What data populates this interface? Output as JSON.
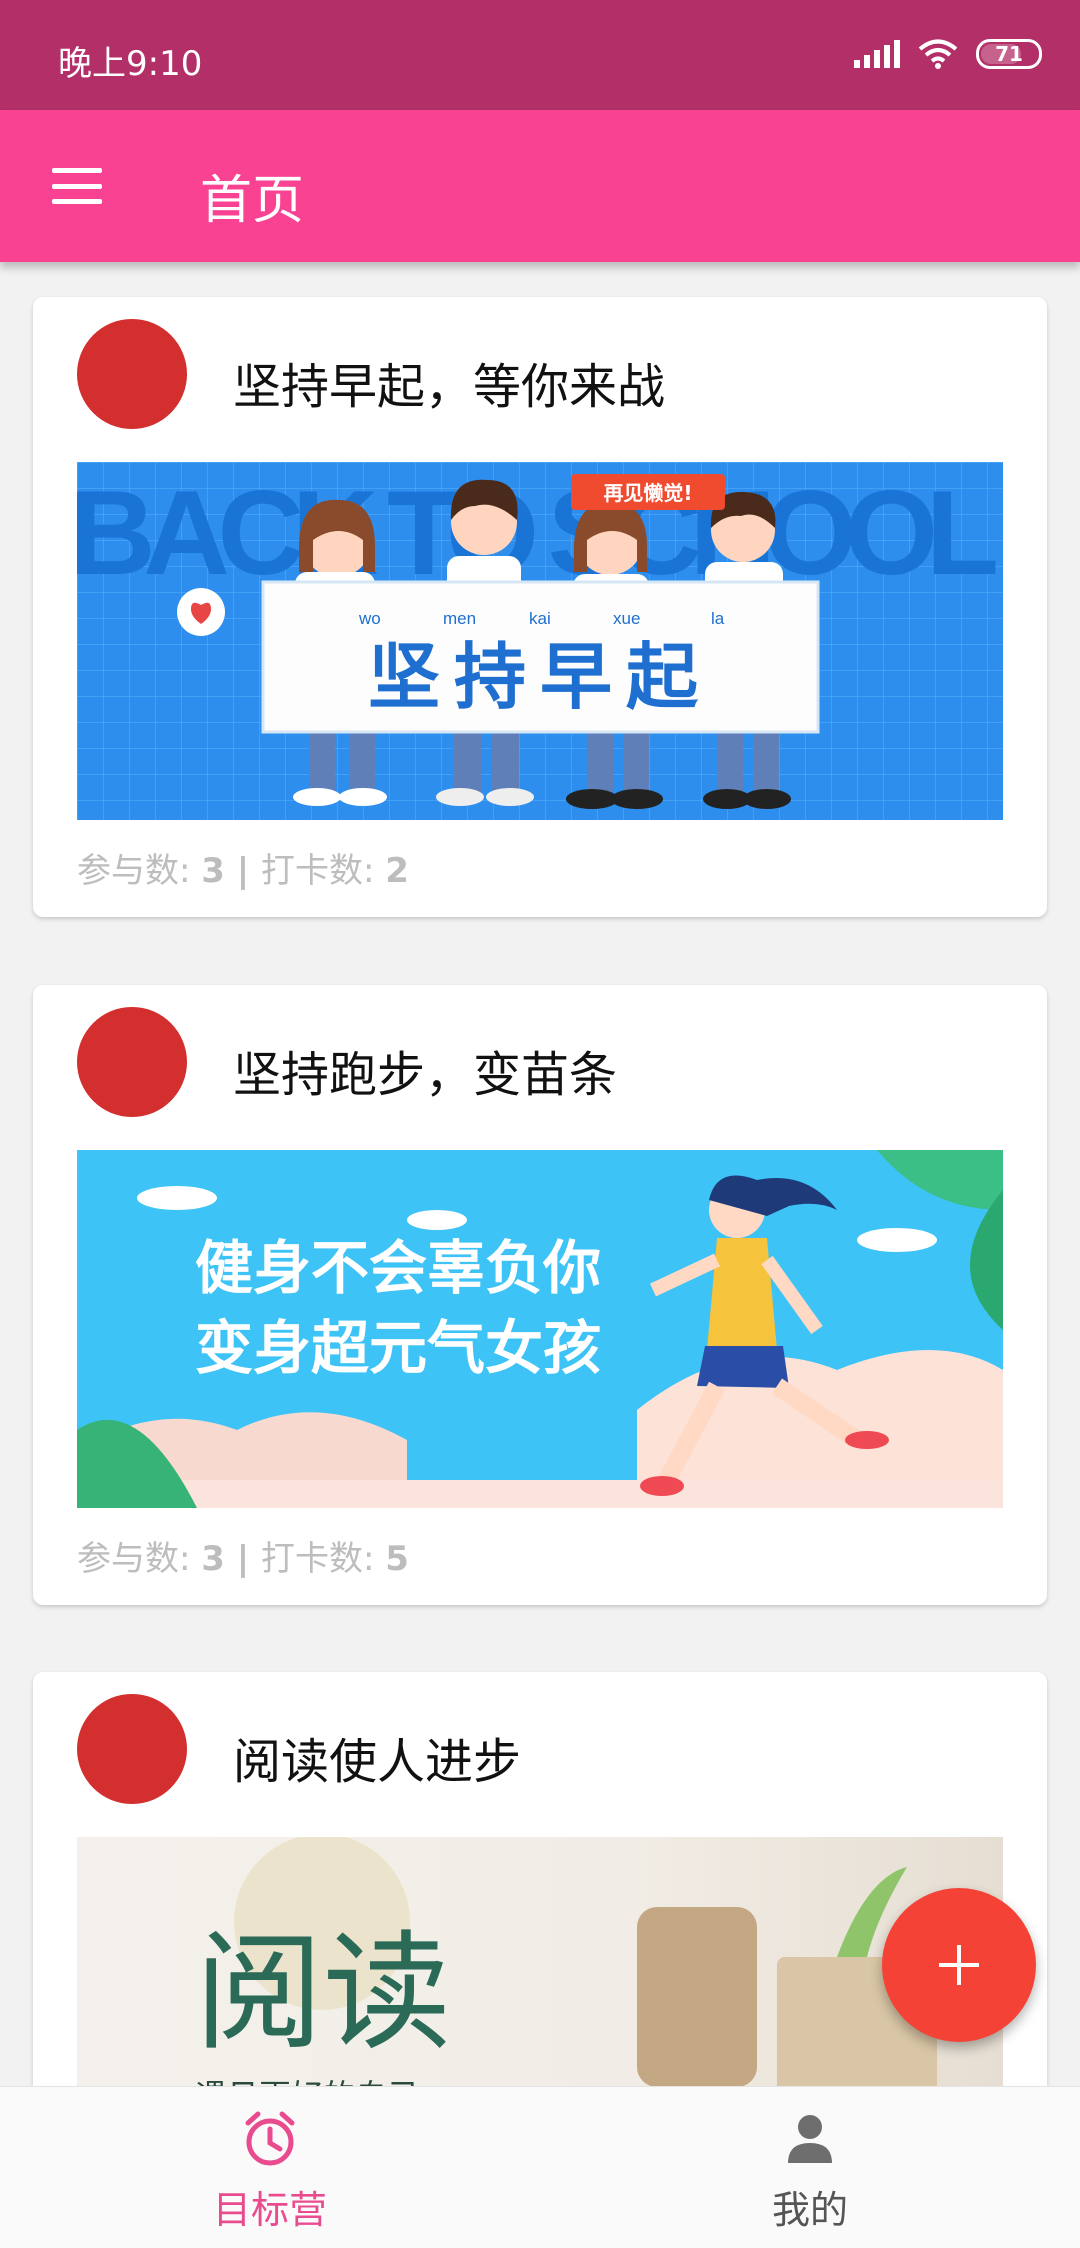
{
  "status_bar": {
    "time": "晚上9:10",
    "battery": "71"
  },
  "app_bar": {
    "title": "首页"
  },
  "cards": [
    {
      "title": "坚持早起，等你来战",
      "banner": {
        "big_text": "坚持早起",
        "pinyin": [
          "wo",
          "men",
          "kai",
          "xue",
          "la"
        ],
        "bg_text": "BACK TO SCHOOL",
        "tag": "再见懒觉!"
      },
      "stats": {
        "participants_label": "参与数: ",
        "participants": "3",
        "sep": " | ",
        "checkins_label": "打卡数: ",
        "checkins": "2"
      }
    },
    {
      "title": "坚持跑步，变苗条",
      "banner": {
        "line1": "健身不会辜负你",
        "line2": "变身超元气女孩"
      },
      "stats": {
        "participants_label": "参与数: ",
        "participants": "3",
        "sep": " | ",
        "checkins_label": "打卡数: ",
        "checkins": "5"
      }
    },
    {
      "title": "阅读使人进步",
      "banner": {
        "big_text": "阅读",
        "subtitle": "遇见更好的自己"
      }
    }
  ],
  "bottom_nav": {
    "items": [
      {
        "label": "目标营",
        "icon": "alarm-clock-icon",
        "active": true
      },
      {
        "label": "我的",
        "icon": "person-icon",
        "active": false
      }
    ]
  },
  "fab": {
    "label": "+"
  },
  "colors": {
    "status": "#b22f67",
    "primary": "#f94392",
    "accent": "#f44336",
    "avatar": "#d32f2f",
    "nav_active": "#e94b8f"
  }
}
